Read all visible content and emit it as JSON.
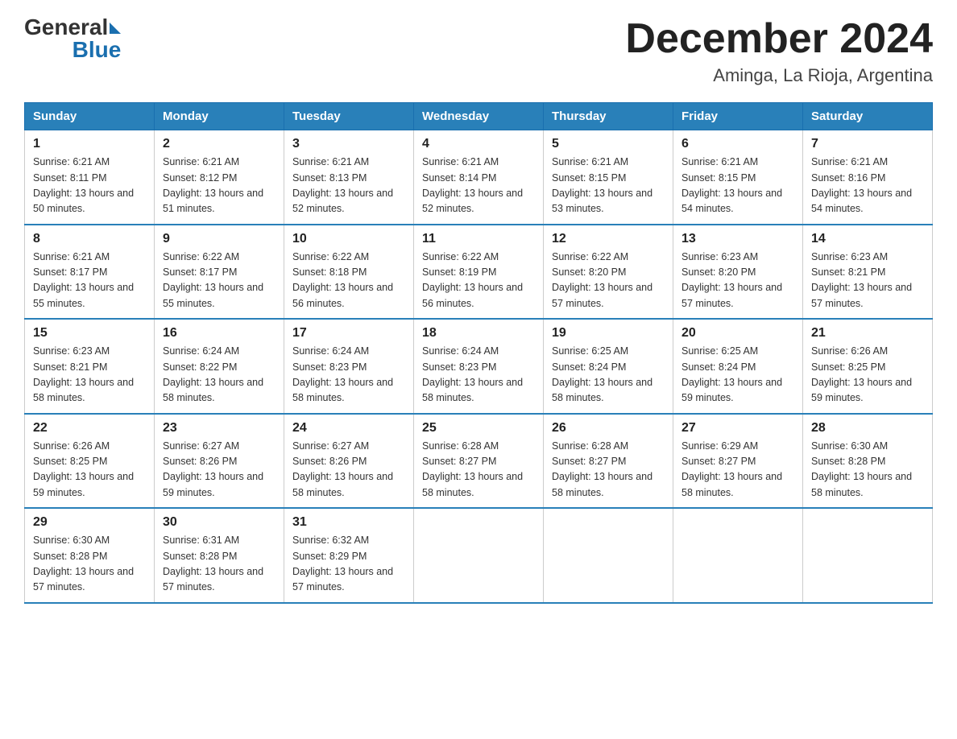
{
  "header": {
    "logo_general": "General",
    "logo_blue": "Blue",
    "title": "December 2024",
    "subtitle": "Aminga, La Rioja, Argentina"
  },
  "calendar": {
    "days_of_week": [
      "Sunday",
      "Monday",
      "Tuesday",
      "Wednesday",
      "Thursday",
      "Friday",
      "Saturday"
    ],
    "weeks": [
      [
        {
          "day": "1",
          "sunrise": "6:21 AM",
          "sunset": "8:11 PM",
          "daylight": "13 hours and 50 minutes."
        },
        {
          "day": "2",
          "sunrise": "6:21 AM",
          "sunset": "8:12 PM",
          "daylight": "13 hours and 51 minutes."
        },
        {
          "day": "3",
          "sunrise": "6:21 AM",
          "sunset": "8:13 PM",
          "daylight": "13 hours and 52 minutes."
        },
        {
          "day": "4",
          "sunrise": "6:21 AM",
          "sunset": "8:14 PM",
          "daylight": "13 hours and 52 minutes."
        },
        {
          "day": "5",
          "sunrise": "6:21 AM",
          "sunset": "8:15 PM",
          "daylight": "13 hours and 53 minutes."
        },
        {
          "day": "6",
          "sunrise": "6:21 AM",
          "sunset": "8:15 PM",
          "daylight": "13 hours and 54 minutes."
        },
        {
          "day": "7",
          "sunrise": "6:21 AM",
          "sunset": "8:16 PM",
          "daylight": "13 hours and 54 minutes."
        }
      ],
      [
        {
          "day": "8",
          "sunrise": "6:21 AM",
          "sunset": "8:17 PM",
          "daylight": "13 hours and 55 minutes."
        },
        {
          "day": "9",
          "sunrise": "6:22 AM",
          "sunset": "8:17 PM",
          "daylight": "13 hours and 55 minutes."
        },
        {
          "day": "10",
          "sunrise": "6:22 AM",
          "sunset": "8:18 PM",
          "daylight": "13 hours and 56 minutes."
        },
        {
          "day": "11",
          "sunrise": "6:22 AM",
          "sunset": "8:19 PM",
          "daylight": "13 hours and 56 minutes."
        },
        {
          "day": "12",
          "sunrise": "6:22 AM",
          "sunset": "8:20 PM",
          "daylight": "13 hours and 57 minutes."
        },
        {
          "day": "13",
          "sunrise": "6:23 AM",
          "sunset": "8:20 PM",
          "daylight": "13 hours and 57 minutes."
        },
        {
          "day": "14",
          "sunrise": "6:23 AM",
          "sunset": "8:21 PM",
          "daylight": "13 hours and 57 minutes."
        }
      ],
      [
        {
          "day": "15",
          "sunrise": "6:23 AM",
          "sunset": "8:21 PM",
          "daylight": "13 hours and 58 minutes."
        },
        {
          "day": "16",
          "sunrise": "6:24 AM",
          "sunset": "8:22 PM",
          "daylight": "13 hours and 58 minutes."
        },
        {
          "day": "17",
          "sunrise": "6:24 AM",
          "sunset": "8:23 PM",
          "daylight": "13 hours and 58 minutes."
        },
        {
          "day": "18",
          "sunrise": "6:24 AM",
          "sunset": "8:23 PM",
          "daylight": "13 hours and 58 minutes."
        },
        {
          "day": "19",
          "sunrise": "6:25 AM",
          "sunset": "8:24 PM",
          "daylight": "13 hours and 58 minutes."
        },
        {
          "day": "20",
          "sunrise": "6:25 AM",
          "sunset": "8:24 PM",
          "daylight": "13 hours and 59 minutes."
        },
        {
          "day": "21",
          "sunrise": "6:26 AM",
          "sunset": "8:25 PM",
          "daylight": "13 hours and 59 minutes."
        }
      ],
      [
        {
          "day": "22",
          "sunrise": "6:26 AM",
          "sunset": "8:25 PM",
          "daylight": "13 hours and 59 minutes."
        },
        {
          "day": "23",
          "sunrise": "6:27 AM",
          "sunset": "8:26 PM",
          "daylight": "13 hours and 59 minutes."
        },
        {
          "day": "24",
          "sunrise": "6:27 AM",
          "sunset": "8:26 PM",
          "daylight": "13 hours and 58 minutes."
        },
        {
          "day": "25",
          "sunrise": "6:28 AM",
          "sunset": "8:27 PM",
          "daylight": "13 hours and 58 minutes."
        },
        {
          "day": "26",
          "sunrise": "6:28 AM",
          "sunset": "8:27 PM",
          "daylight": "13 hours and 58 minutes."
        },
        {
          "day": "27",
          "sunrise": "6:29 AM",
          "sunset": "8:27 PM",
          "daylight": "13 hours and 58 minutes."
        },
        {
          "day": "28",
          "sunrise": "6:30 AM",
          "sunset": "8:28 PM",
          "daylight": "13 hours and 58 minutes."
        }
      ],
      [
        {
          "day": "29",
          "sunrise": "6:30 AM",
          "sunset": "8:28 PM",
          "daylight": "13 hours and 57 minutes."
        },
        {
          "day": "30",
          "sunrise": "6:31 AM",
          "sunset": "8:28 PM",
          "daylight": "13 hours and 57 minutes."
        },
        {
          "day": "31",
          "sunrise": "6:32 AM",
          "sunset": "8:29 PM",
          "daylight": "13 hours and 57 minutes."
        },
        null,
        null,
        null,
        null
      ]
    ]
  }
}
